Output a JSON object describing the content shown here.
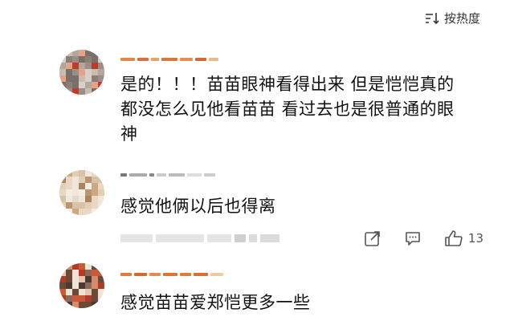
{
  "sort": {
    "label": "按热度"
  },
  "comments": [
    {
      "text_lines": [
        "是的！！！苗苗眼神看得出来 但是恺恺真的",
        "都没怎么见他看苗苗 看过去也是很普通的眼",
        "神"
      ]
    },
    {
      "text_lines": [
        "感觉他俩以后也得离"
      ],
      "like_count": "13"
    },
    {
      "text_lines": [
        "感觉苗苗爱郑恺更多一些"
      ]
    }
  ],
  "colors": {
    "text": "#111111",
    "icon": "#555555",
    "blur": "#d8d8d8",
    "username_blur": "#e07b3a"
  }
}
